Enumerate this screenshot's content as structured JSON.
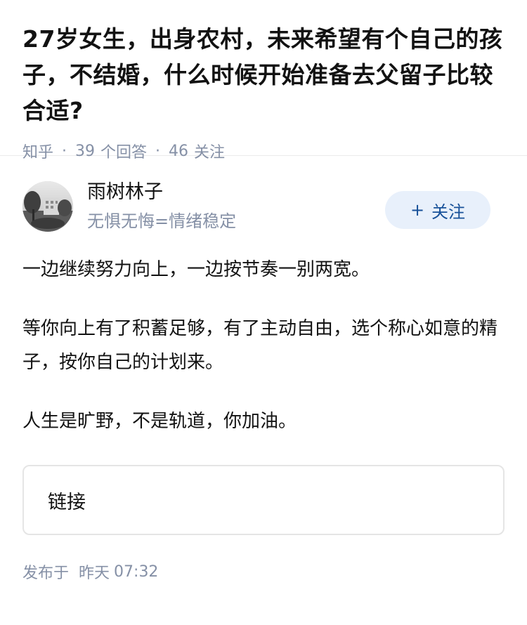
{
  "question": {
    "title": "27岁女生，出身农村，未来希望有个自己的孩子，不结婚，什么时候开始准备去父留子比较合适?",
    "source": "知乎",
    "answer_count": "39",
    "answer_label": "个回答",
    "follow_count": "46",
    "follow_label": "关注"
  },
  "answer": {
    "author": {
      "name": "雨树林子",
      "bio": "无惧无悔=情绪稳定",
      "avatar_icon": "avatar-photo"
    },
    "follow_button": {
      "icon": "+",
      "label": "关注"
    },
    "paragraphs": [
      "一边继续努力向上，一边按节奏一别两宽。",
      "等你向上有了积蓄足够，有了主动自由，选个称心如意的精子，按你自己的计划来。",
      "人生是旷野，不是轨道，你加油。"
    ],
    "link_card": {
      "label": "链接"
    },
    "publish": {
      "prefix": "发布于",
      "day": "昨天",
      "time": "07:32"
    }
  },
  "colors": {
    "meta_gray": "#8590a6",
    "brand_blue": "#175199",
    "follow_bg": "#e8f0fb"
  }
}
